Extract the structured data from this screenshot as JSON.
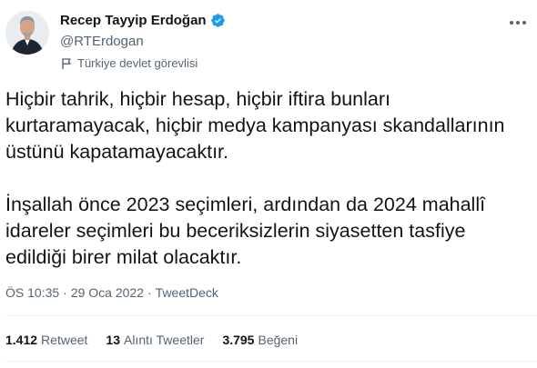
{
  "author": {
    "display_name": "Recep Tayyip Erdoğan",
    "handle": "@RTErdogan",
    "label": "Türkiye devlet görevlisi",
    "verified": true
  },
  "tweet": {
    "paragraphs": [
      "Hiçbir tahrik, hiçbir hesap, hiçbir iftira bunları kurtaramayacak, hiçbir medya kampanyası skandallarının üstünü kapatamayacaktır.",
      "İnşallah önce 2023 seçimleri, ardından da 2024 mahallî idareler seçimleri bu beceriksizlerin siyasetten tasfiye edildiği birer milat olacaktır."
    ]
  },
  "meta": {
    "time": "ÖS 10:35",
    "separator": "·",
    "date": "29 Oca 2022",
    "source": "TweetDeck"
  },
  "stats": {
    "retweets_value": "1.412",
    "retweets_label": "Retweet",
    "quotes_value": "13",
    "quotes_label": "Alıntı Tweetler",
    "likes_value": "3.795",
    "likes_label": "Beğeni"
  },
  "colors": {
    "verified": "#1d9bf0",
    "text": "#0f1419",
    "secondary": "#536471"
  }
}
